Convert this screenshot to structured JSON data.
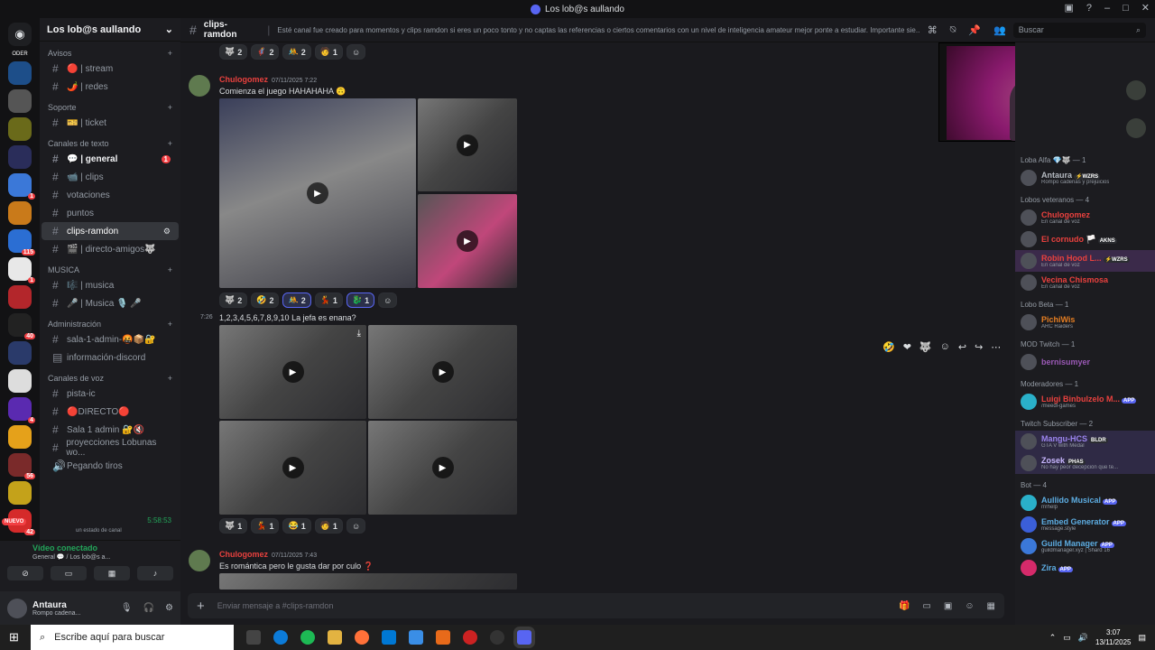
{
  "window": {
    "title": "Los lob@s aullando"
  },
  "server": {
    "name": "Los lob@s aullando"
  },
  "servers": [
    {
      "badge": ""
    },
    {
      "badge": ""
    },
    {
      "badge": ""
    },
    {
      "badge": ""
    },
    {
      "badge": ""
    },
    {
      "badge": "1"
    },
    {
      "badge": ""
    },
    {
      "badge": "115"
    },
    {
      "badge": "1"
    },
    {
      "badge": ""
    },
    {
      "badge": "40"
    },
    {
      "badge": ""
    },
    {
      "badge": ""
    },
    {
      "badge": "4"
    },
    {
      "badge": ""
    },
    {
      "badge": "56"
    },
    {
      "badge": ""
    },
    {
      "badge": "42"
    }
  ],
  "server_labels": {
    "top": "ODER",
    "new": "NUEVO"
  },
  "categories": {
    "avisos": "Avisos",
    "soporte": "Soporte",
    "texto": "Canales de texto",
    "musica": "MUSICA",
    "admin": "Administración",
    "voz": "Canales de voz"
  },
  "channels": {
    "stream": "🔴 | stream",
    "redes": "🌶️ | redes",
    "ticket": "🎫 | ticket",
    "general": "💬 | general",
    "general_badge": "1",
    "clips": "📹 | clips",
    "votaciones": "votaciones",
    "puntos": "puntos",
    "clips_ramdon": "clips-ramdon",
    "directo_amigos": "🎬 | directo-amigos🐺",
    "musica": "🎼 | musica",
    "musica2": "🎤 | Musica 🎙️ 🎤",
    "sala_admin": "sala-1-admin-🤬📦🔐",
    "info_discord": "información-discord",
    "pista_ic": "pista-ic",
    "directo": "🔴DIRECTO🔴",
    "sala1": "Sala 1 admin 🔐🔇",
    "proyecciones": "proyecciones Lobunas wo...",
    "pegando_tiros": "Pegando tiros",
    "timer": "5:58:53",
    "status_hint": "un estado de canal"
  },
  "voice": {
    "title": "Vídeo conectado",
    "sub": "General 💬 / Los lob@s a..."
  },
  "user": {
    "name": "Antaura",
    "status": "Rompo cadena..."
  },
  "channel_header": {
    "name": "clips-ramdon",
    "topic": "Esté canal fue creado para momentos y clips ramdon si eres un poco tonto y no captas las referencias o ciertos comentarios con un nivel de inteligencia amateur mejor ponte a estudiar. Importante sie...",
    "search_placeholder": "Buscar"
  },
  "reactions_top": [
    {
      "e": "🐺",
      "c": "2"
    },
    {
      "e": "🦸",
      "c": "2"
    },
    {
      "e": "🤼",
      "c": "2"
    },
    {
      "e": "🧑",
      "c": "1"
    }
  ],
  "msg1": {
    "author": "Chulogomez",
    "time": "07/11/2025 7:22",
    "text": "Comienza el juego HAHAHAHA 🙃"
  },
  "reactions_1": [
    {
      "e": "🐺",
      "c": "2"
    },
    {
      "e": "🤣",
      "c": "2"
    },
    {
      "e": "🤼",
      "c": "2"
    },
    {
      "e": "💃",
      "c": "1"
    },
    {
      "e": "🐉",
      "c": "1"
    }
  ],
  "msg2": {
    "time": "7:26",
    "text": "1,2,3,4,5,6,7,8,9,10 La jefa es enana?"
  },
  "reactions_2": [
    {
      "e": "🐺",
      "c": "1"
    },
    {
      "e": "💃",
      "c": "1"
    },
    {
      "e": "😂",
      "c": "1"
    },
    {
      "e": "🧑",
      "c": "1"
    }
  ],
  "msg3": {
    "author": "Chulogomez",
    "time": "07/11/2025 7:43",
    "text": "Es romántica pero le gusta dar por culo ❓"
  },
  "composer": {
    "placeholder": "Enviar mensaje a #clips-ramdon"
  },
  "members": {
    "cat1": "Loba Alfa 💎🐺 — 1",
    "antaura": {
      "name": "Antaura",
      "tag": "⚡WZRS",
      "status": "Rompo cadenas y prejuicios"
    },
    "cat2": "Lobos veteranos — 4",
    "chulo": {
      "name": "Chulogomez",
      "status": "En canal de voz"
    },
    "cornudo": {
      "name": "El cornudo 🏳️",
      "tag": "AKNS"
    },
    "robin": {
      "name": "Robin Hood L...",
      "tag": "⚡WZRS",
      "status": "En canal de voz"
    },
    "vecina": {
      "name": "Vecina Chismosa",
      "status": "En canal de voz"
    },
    "cat3": "Lobo Beta — 1",
    "pichi": {
      "name": "PichiWis",
      "status": "ARC Raiders"
    },
    "cat4": "MOD Twitch — 1",
    "bern": {
      "name": "bernisumyer"
    },
    "cat5": "Moderadores — 1",
    "luigi": {
      "name": "Luigi Binbulzelo M...",
      "tag": "APP",
      "status": "/meedl-games"
    },
    "cat6": "Twitch Subscriber — 2",
    "mangu": {
      "name": "Mangu-HCS",
      "tag": "BLDR",
      "status": "GTA V with Medal"
    },
    "zosek": {
      "name": "Zosek",
      "tag": "PHAS",
      "status": "No hay peor decepción que te..."
    },
    "cat7": "Bot — 4",
    "aullido": {
      "name": "Aullido Musical",
      "tag": "APP",
      "status": "m!help"
    },
    "embed": {
      "name": "Embed Generator",
      "tag": "APP",
      "status": "message.style"
    },
    "guild": {
      "name": "Guild Manager",
      "tag": "APP",
      "status": "guildmanager.xyz | Shard 16"
    },
    "zira": {
      "name": "Zira",
      "tag": "APP"
    }
  },
  "taskbar": {
    "search": "Escribe aquí para buscar",
    "time": "3:07",
    "date": "13/11/2025"
  },
  "colors": {
    "accent": "#5865f2",
    "mention_red": "#f23f43",
    "online": "#23a55a"
  }
}
